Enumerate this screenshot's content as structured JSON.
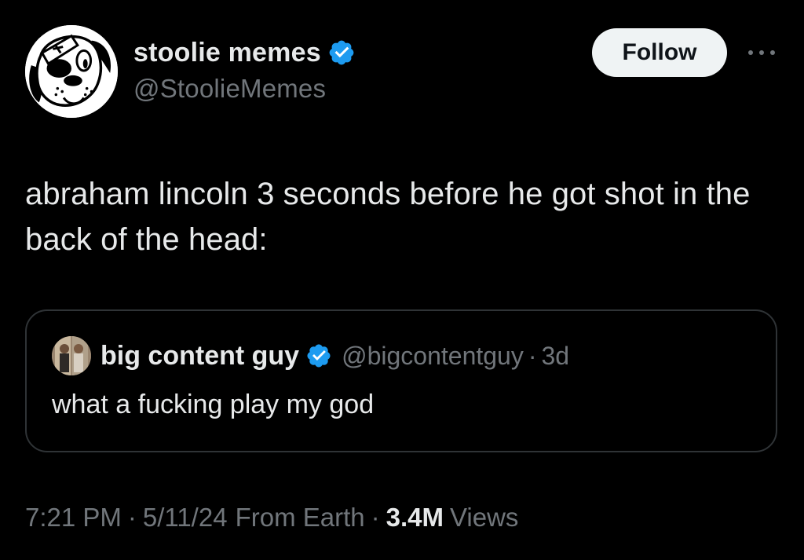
{
  "tweet": {
    "author": {
      "display_name": "stoolie memes",
      "handle": "@StoolieMemes",
      "verified": true
    },
    "follow_label": "Follow",
    "text": "abraham lincoln 3 seconds before he got shot in the back of the head:",
    "quoted": {
      "display_name": "big content guy",
      "handle": "@bigcontentguy",
      "separator": "·",
      "time": "3d",
      "text": "what a fucking play my god"
    },
    "meta": {
      "time": "7:21 PM",
      "separator": "·",
      "date": "5/11/24",
      "source": "From Earth",
      "views_count": "3.4M",
      "views_label": "Views"
    }
  },
  "icons": {
    "avatar": "cartoon-dog-avatar",
    "verified": "verified-badge-icon",
    "more": "more-options-icon"
  },
  "colors": {
    "background": "#000000",
    "text_primary": "#e7e9ea",
    "text_secondary": "#71767b",
    "verified_blue": "#1d9bf0",
    "follow_bg": "#eff3f4",
    "border": "#2f3336"
  }
}
